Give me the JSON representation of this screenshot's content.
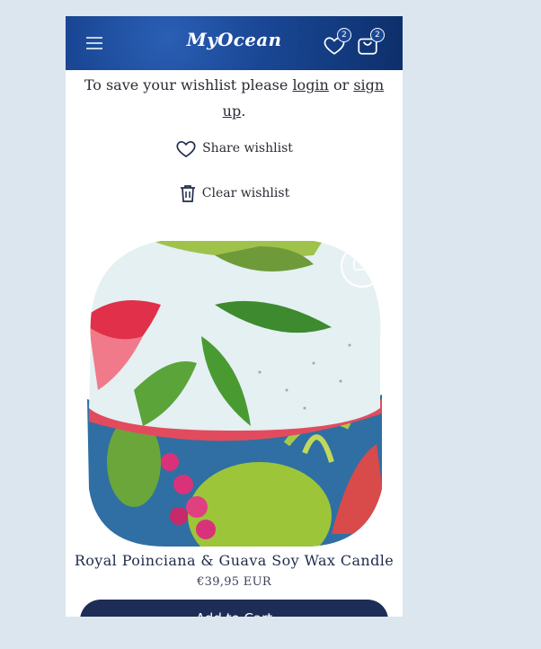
{
  "header": {
    "logo_text": "MyOcean",
    "wishlist_count": "2",
    "cart_count": "2"
  },
  "notice": {
    "text_before": "To save your wishlist please ",
    "login_label": "login",
    "text_middle": " or ",
    "signup_label": "sign up",
    "text_after": "."
  },
  "actions": {
    "share_label": "Share wishlist",
    "clear_label": "Clear wishlist"
  },
  "product": {
    "title": "Royal Poinciana & Guava Soy Wax Candle",
    "price": "€39,95 EUR",
    "add_to_cart_label": "Add to Cart"
  },
  "colors": {
    "header_blue": "#1a4795",
    "button_navy": "#1e2d55",
    "page_bg": "#dce6ee"
  },
  "icons": {
    "menu": "menu-icon",
    "wishlist": "heart-icon",
    "cart": "shopping-bag-icon",
    "share": "heart-outline-icon",
    "clear": "trash-icon",
    "compare": "compare-icon"
  }
}
